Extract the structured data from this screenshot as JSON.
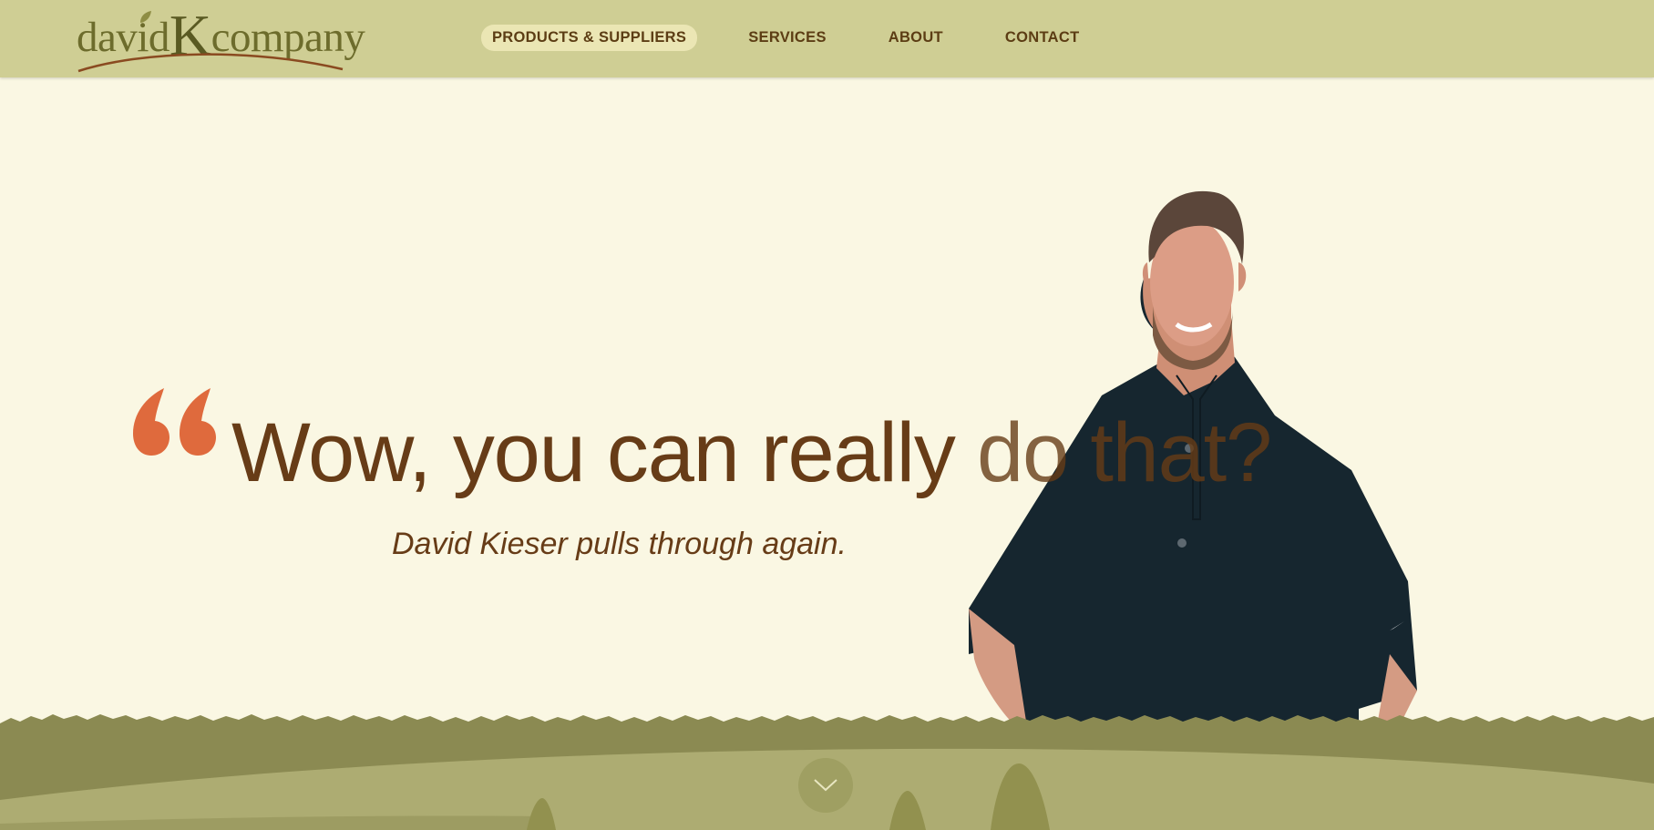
{
  "brand": {
    "logo_text_left": "david",
    "logo_text_k": "K",
    "logo_text_right": "company"
  },
  "nav": {
    "items": [
      {
        "label": "PRODUCTS & SUPPLIERS",
        "active": true
      },
      {
        "label": "SERVICES"
      },
      {
        "label": "ABOUT"
      },
      {
        "label": "CONTACT"
      }
    ]
  },
  "hero": {
    "headline_part1": "Wow, you can really ",
    "headline_part2": "do that?",
    "subline": "David Kieser pulls through again."
  },
  "icons": {
    "quote": "quote-icon",
    "scroll": "chevron-down-icon"
  },
  "colors": {
    "header_bg": "#cfce94",
    "page_bg": "#faf7e3",
    "text_brown": "#673c17",
    "accent_orange": "#df6a3d",
    "hill_dark": "#8b8a52",
    "hill_light": "#adac72"
  }
}
